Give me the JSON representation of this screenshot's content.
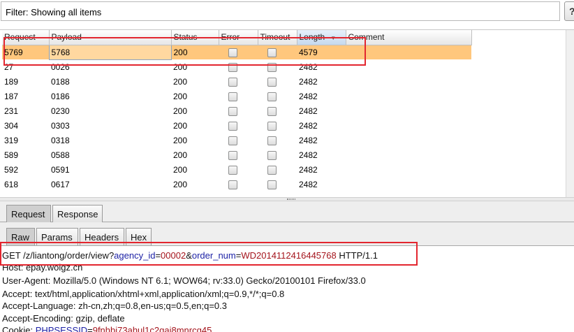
{
  "filter": {
    "text": "Filter: Showing all items",
    "help_label": "?"
  },
  "table": {
    "columns": [
      "Request",
      "Payload",
      "Status",
      "Error",
      "Timeout",
      "Length",
      "Comment"
    ],
    "sorted_column": "Length",
    "rows": [
      {
        "request": "5769",
        "payload": "5768",
        "status": "200",
        "length": "4579",
        "selected": true
      },
      {
        "request": "27",
        "payload": "0026",
        "status": "200",
        "length": "2482"
      },
      {
        "request": "189",
        "payload": "0188",
        "status": "200",
        "length": "2482"
      },
      {
        "request": "187",
        "payload": "0186",
        "status": "200",
        "length": "2482"
      },
      {
        "request": "231",
        "payload": "0230",
        "status": "200",
        "length": "2482"
      },
      {
        "request": "304",
        "payload": "0303",
        "status": "200",
        "length": "2482"
      },
      {
        "request": "319",
        "payload": "0318",
        "status": "200",
        "length": "2482"
      },
      {
        "request": "589",
        "payload": "0588",
        "status": "200",
        "length": "2482"
      },
      {
        "request": "592",
        "payload": "0591",
        "status": "200",
        "length": "2482"
      },
      {
        "request": "618",
        "payload": "0617",
        "status": "200",
        "length": "2482"
      }
    ]
  },
  "outer_tabs": [
    "Request",
    "Response"
  ],
  "inner_tabs": [
    "Raw",
    "Params",
    "Headers",
    "Hex"
  ],
  "request_raw": {
    "first_line": {
      "method_path": "GET /z/liantong/order/view?",
      "param1_name": "agency_id",
      "eq1": "=",
      "param1_value": "00002",
      "amp": "&",
      "param2_name": "order_num",
      "eq2": "=",
      "param2_value": "WD2014112416445768",
      "protocol": " HTTP/1.1"
    },
    "host": "Host: epay.wolgz.cn",
    "user_agent": "User-Agent: Mozilla/5.0 (Windows NT 6.1; WOW64; rv:33.0) Gecko/20100101 Firefox/33.0",
    "accept": "Accept: text/html,application/xhtml+xml,application/xml;q=0.9,*/*;q=0.8",
    "accept_language": "Accept-Language: zh-cn,zh;q=0.8,en-us;q=0.5,en;q=0.3",
    "accept_encoding": "Accept-Encoding: gzip, deflate",
    "cookie_name": "Cookie: ",
    "cookie_key": "PHPSESSID",
    "cookie_eq": "=",
    "cookie_value": "9fnhbi73ahul1c2gai8mnrcg45"
  },
  "colors": {
    "selected_row": "#ffc77d",
    "highlight_box": "#e3262f",
    "param_name": "#1d22a6",
    "param_value": "#a4141c"
  }
}
